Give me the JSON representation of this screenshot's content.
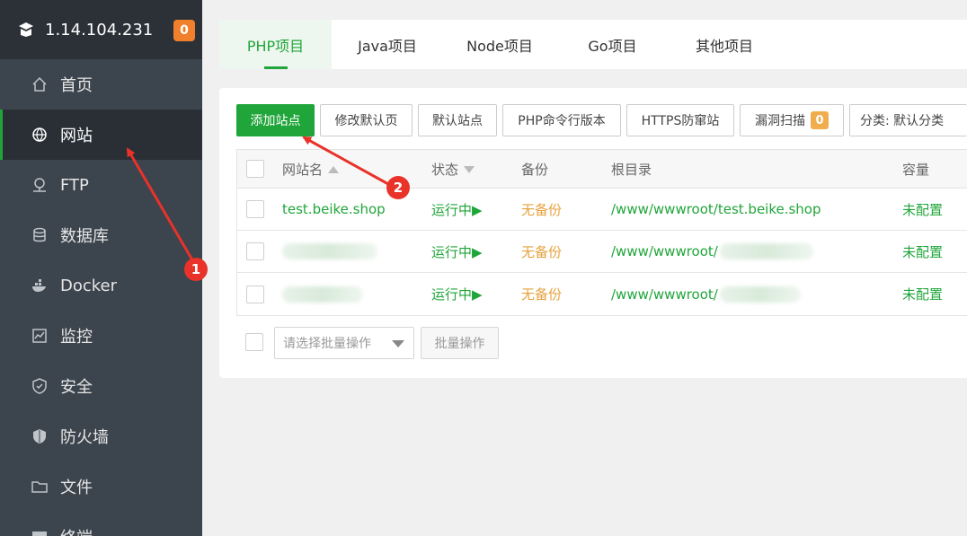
{
  "server": {
    "ip": "1.14.104.231",
    "badge": "0"
  },
  "sidebar": {
    "items": [
      {
        "label": "首页",
        "icon": "home-icon"
      },
      {
        "label": "网站",
        "icon": "globe-icon",
        "active": true
      },
      {
        "label": "FTP",
        "icon": "ftp-icon"
      },
      {
        "label": "数据库",
        "icon": "database-icon"
      },
      {
        "label": "Docker",
        "icon": "docker-icon"
      },
      {
        "label": "监控",
        "icon": "monitor-icon"
      },
      {
        "label": "安全",
        "icon": "shield-icon"
      },
      {
        "label": "防火墙",
        "icon": "firewall-icon"
      },
      {
        "label": "文件",
        "icon": "folder-icon"
      },
      {
        "label": "终端",
        "icon": "terminal-icon"
      }
    ]
  },
  "tabs": [
    "PHP项目",
    "Java项目",
    "Node项目",
    "Go项目",
    "其他项目"
  ],
  "toolbar": {
    "add_site": "添加站点",
    "edit_default_page": "修改默认页",
    "default_site": "默认站点",
    "php_cli_version": "PHP命令行版本",
    "https_guard": "HTTPS防窜站",
    "vuln_scan": "漏洞扫描",
    "vuln_count": "0",
    "category": "分类: 默认分类"
  },
  "table": {
    "headers": {
      "name": "网站名",
      "status": "状态",
      "backup": "备份",
      "root": "根目录",
      "capacity": "容量"
    },
    "rows": [
      {
        "name": "test.beike.shop",
        "status": "运行中▶",
        "backup": "无备份",
        "root": "/www/wwwroot/test.beike.shop",
        "capacity": "未配置"
      },
      {
        "name": "",
        "status": "运行中▶",
        "backup": "无备份",
        "root": "/www/wwwroot/",
        "capacity": "未配置"
      },
      {
        "name": "",
        "status": "运行中▶",
        "backup": "无备份",
        "root": "/www/wwwroot/",
        "capacity": "未配置"
      }
    ]
  },
  "footer": {
    "batch_placeholder": "请选择批量操作",
    "batch_button": "批量操作"
  },
  "annotations": [
    "1",
    "2"
  ],
  "colors": {
    "accent": "#20a53a",
    "badge": "#f0802c",
    "warning": "#e6a23c",
    "annotation": "#e8322a"
  }
}
